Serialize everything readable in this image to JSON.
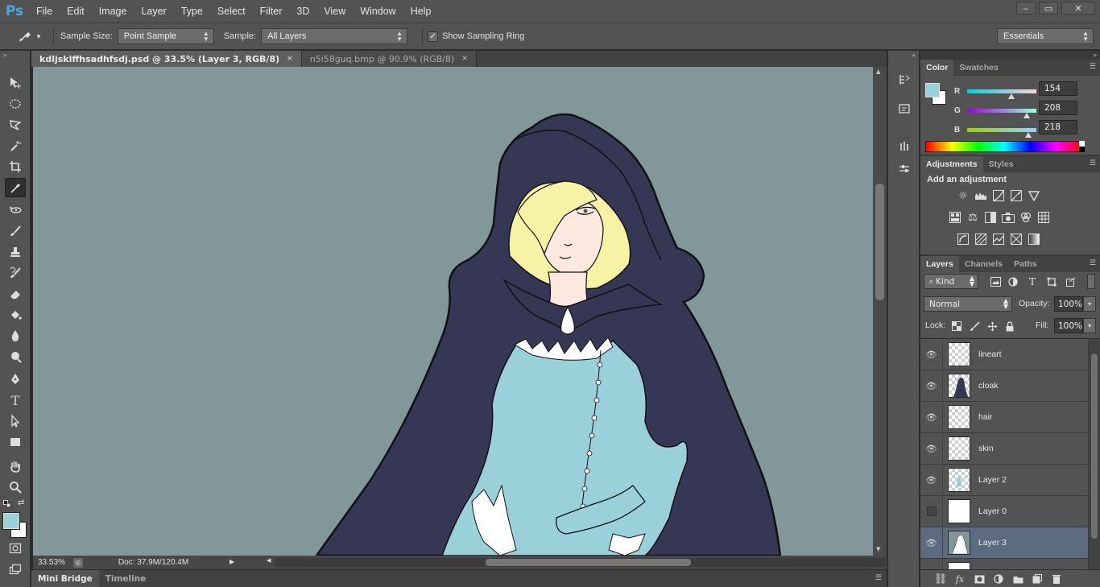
{
  "app": {
    "logo": "Ps",
    "menu": [
      "File",
      "Edit",
      "Image",
      "Layer",
      "Type",
      "Select",
      "Filter",
      "3D",
      "View",
      "Window",
      "Help"
    ],
    "window_controls": [
      "‒",
      "▭",
      "✕"
    ]
  },
  "options": {
    "sample_size_label": "Sample Size:",
    "sample_size_value": "Point Sample",
    "sample_label": "Sample:",
    "sample_value": "All Layers",
    "show_ring_label": "Show Sampling Ring",
    "workspace": "Essentials"
  },
  "tabs": [
    {
      "label": "kdljsklffhsadhfsdj.psd @ 33.5% (Layer 3, RGB/8)",
      "close": "×"
    },
    {
      "label": "n5i58guq.bmp @ 90.9% (RGB/8)",
      "close": "×"
    }
  ],
  "status": {
    "zoom": "33.53%",
    "doc": "Doc: 37.9M/120.4M"
  },
  "bottom_tabs": [
    "Mini Bridge",
    "Timeline"
  ],
  "color_panel": {
    "tabs": [
      "Color",
      "Swatches"
    ],
    "fg_color": "#9ad0da",
    "r_label": "R",
    "r_value": "154",
    "g_label": "G",
    "g_value": "208",
    "b_label": "B",
    "b_value": "218"
  },
  "adjustments": {
    "tabs": [
      "Adjustments",
      "Styles"
    ],
    "title": "Add an adjustment"
  },
  "layers_panel": {
    "tabs": [
      "Layers",
      "Channels",
      "Paths"
    ],
    "kind": "Kind",
    "blend_mode": "Normal",
    "opacity_label": "Opacity:",
    "opacity_value": "100%",
    "lock_label": "Lock:",
    "fill_label": "Fill:",
    "fill_value": "100%",
    "layers": [
      {
        "name": "lineart",
        "visible": true
      },
      {
        "name": "cloak",
        "visible": true
      },
      {
        "name": "hair",
        "visible": true
      },
      {
        "name": "skin",
        "visible": true
      },
      {
        "name": "Layer 2",
        "visible": true
      },
      {
        "name": "Layer 0",
        "visible": false
      },
      {
        "name": "Layer 3",
        "visible": true,
        "selected": true
      }
    ]
  },
  "colors": {
    "canvas_bg": "#829799",
    "cloak": "#363755",
    "hair": "#f7f2a6",
    "skin": "#fde9e0",
    "dress": "#9ad0da"
  }
}
